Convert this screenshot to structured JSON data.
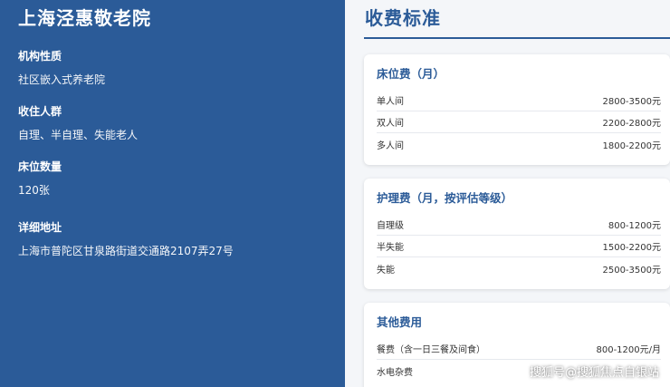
{
  "left": {
    "title": "上海泾惠敬老院",
    "items": [
      {
        "label": "机构性质",
        "value": "社区嵌入式养老院"
      },
      {
        "label": "收住人群",
        "value": "自理、半自理、失能老人"
      },
      {
        "label": "床位数量",
        "value": "120张"
      },
      {
        "label": "详细地址",
        "value": "上海市普陀区甘泉路街道交通路2107弄27号"
      }
    ]
  },
  "right": {
    "heading": "收费标准",
    "cards": [
      {
        "title": "床位费（月）",
        "rows": [
          {
            "name": "单人间",
            "price": "2800-3500元"
          },
          {
            "name": "双人间",
            "price": "2200-2800元"
          },
          {
            "name": "多人间",
            "price": "1800-2200元"
          }
        ]
      },
      {
        "title": "护理费（月，按评估等级）",
        "rows": [
          {
            "name": "自理级",
            "price": "800-1200元"
          },
          {
            "name": "半失能",
            "price": "1500-2200元"
          },
          {
            "name": "失能",
            "price": "2500-3500元"
          }
        ]
      },
      {
        "title": "其他费用",
        "rows": [
          {
            "name": "餐费（含一日三餐及间食）",
            "price": "800-1200元/月"
          },
          {
            "name": "水电杂费",
            "price": ""
          }
        ]
      }
    ]
  },
  "watermark": "搜狐号@搜狐焦点自银站"
}
